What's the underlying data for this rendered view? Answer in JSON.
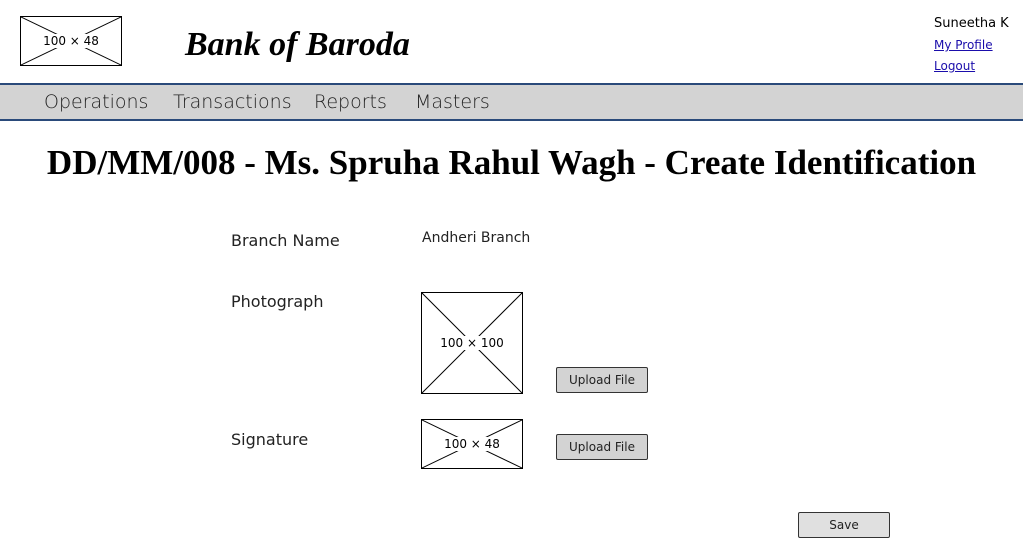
{
  "header": {
    "logo_placeholder": "100 × 48",
    "bank_name": "Bank of Baroda",
    "user_name": "Suneetha K",
    "my_profile_link": "My Profile",
    "logout_link": "Logout"
  },
  "nav": {
    "items": [
      "Operations",
      "Transactions",
      "Reports",
      "Masters"
    ]
  },
  "page": {
    "title": "DD/MM/008 - Ms. Spruha Rahul Wagh  - Create Identification"
  },
  "form": {
    "branch_label": "Branch Name",
    "branch_value": "Andheri Branch",
    "photo_label": "Photograph",
    "photo_placeholder": "100 × 100",
    "photo_upload_label": "Upload File",
    "signature_label": "Signature",
    "signature_placeholder": "100 × 48",
    "signature_upload_label": "Upload File",
    "save_label": "Save"
  },
  "colors": {
    "nav_background": "#d3d3d3",
    "nav_border": "#2a4a7a",
    "link": "#1a0dab"
  }
}
